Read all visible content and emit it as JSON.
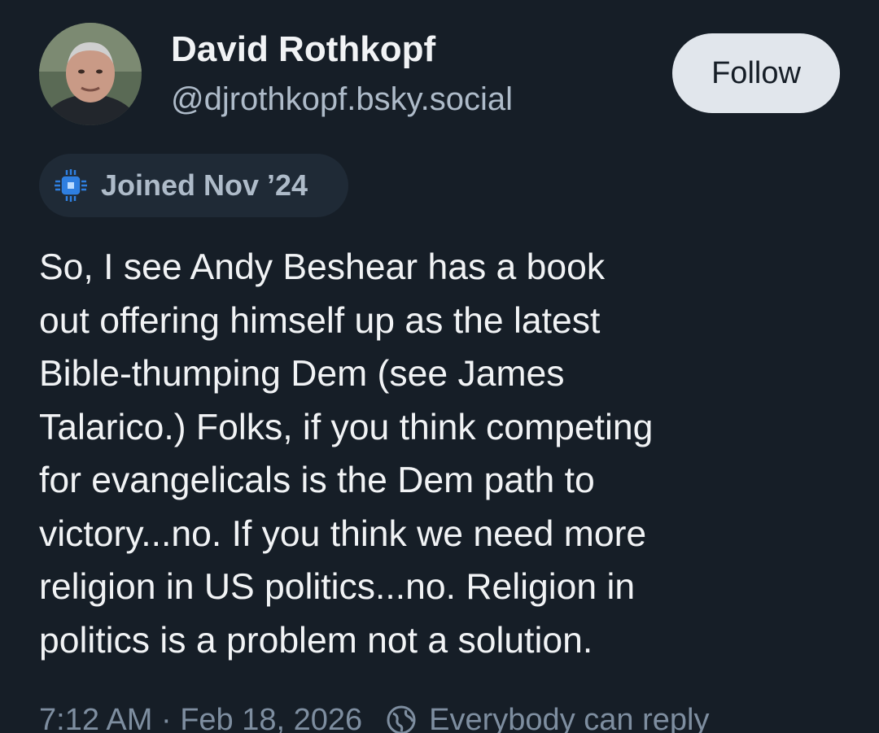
{
  "author": {
    "display_name": "David Rothkopf",
    "handle": "@djrothkopf.bsky.social",
    "avatar_icon": "user-avatar-photo"
  },
  "follow_button": {
    "label": "Follow"
  },
  "joined_badge": {
    "icon": "new-member-badge-icon",
    "text": "Joined Nov ’24"
  },
  "post": {
    "lines": [
      "So, I see Andy Beshear has a book",
      "out offering himself up as the latest",
      "Bible-thumping Dem (see James",
      "Talarico.) Folks, if you think competing",
      "for evangelicals is the Dem path to",
      "victory...no. If you think we need more",
      "religion in US politics...no. Religion in",
      "politics is a problem not a solution."
    ]
  },
  "meta": {
    "timestamp": "7:12 AM · Feb 18, 2026",
    "reply_icon": "globe-icon",
    "reply_setting": "Everybody can reply"
  },
  "colors": {
    "background": "#161e27",
    "primary_text": "#f1f3f5",
    "secondary_text": "#aebbc9",
    "muted_text": "#7e8ea0",
    "button_bg": "#e1e6ec",
    "badge_bg": "#1f2a36",
    "badge_icon": "#2f7fe0"
  }
}
